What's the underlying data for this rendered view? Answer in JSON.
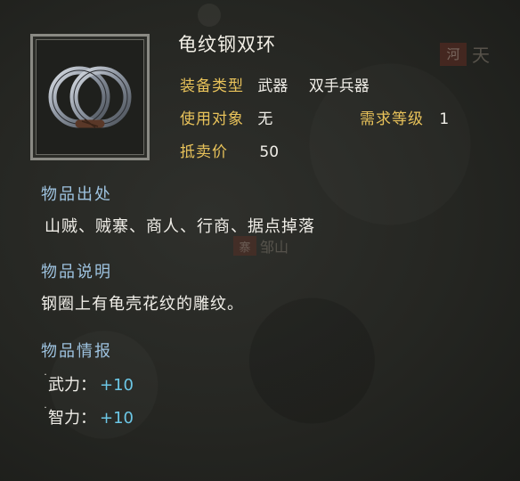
{
  "item": {
    "name": "龟纹钢双环",
    "icon": "twin-steel-rings-icon"
  },
  "attributes": {
    "equip_type_label": "装备类型",
    "equip_type_value": "武器",
    "equip_subtype_value": "双手兵器",
    "target_label": "使用对象",
    "target_value": "无",
    "req_level_label": "需求等级",
    "req_level_value": "1",
    "sell_price_label": "抵卖价",
    "sell_price_value": "50"
  },
  "sections": {
    "source_title": "物品出处",
    "source_text": "山贼、贼寨、商人、行商、据点掉落",
    "desc_title": "物品说明",
    "desc_text": "钢圈上有龟壳花纹的雕纹。",
    "info_title": "物品情报"
  },
  "stats": [
    {
      "name": "武力：",
      "value": "+10"
    },
    {
      "name": "智力：",
      "value": "+10"
    }
  ],
  "map_labels": {
    "right_seal": "河",
    "right_text": "天",
    "mid_seal": "寨",
    "mid_text": "邹山"
  },
  "colors": {
    "label_gold": "#e8c25a",
    "section_blue": "#9ec3e0",
    "stat_cyan": "#6cc7e6"
  }
}
